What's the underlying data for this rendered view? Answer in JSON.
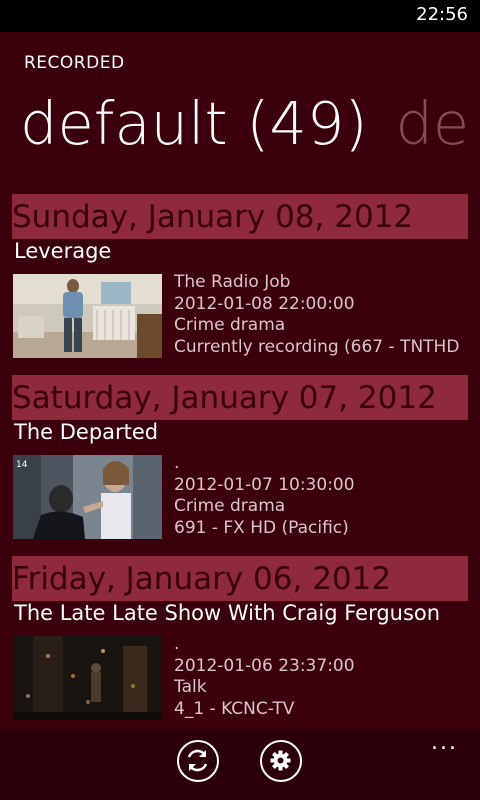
{
  "status_bar": {
    "time": "22:56"
  },
  "app": {
    "title": "RECORDED"
  },
  "pivot": {
    "active": "default (49)",
    "next_peek": "de"
  },
  "recordings": [
    {
      "date": "Sunday, January 08, 2012",
      "title": "Leverage",
      "details": [
        "The Radio Job",
        "2012-01-08 22:00:00",
        "Crime drama",
        "Currently recording (667 - TNTHD"
      ]
    },
    {
      "date": "Saturday, January 07, 2012",
      "title": "The Departed",
      "details": [
        ".",
        "2012-01-07 10:30:00",
        "Crime drama",
        "691 - FX HD (Pacific)"
      ]
    },
    {
      "date": "Friday, January 06, 2012",
      "title": "The Late Late Show With Craig Ferguson",
      "details": [
        ".",
        "2012-01-06 23:37:00",
        "Talk",
        "4_1 - KCNC-TV"
      ]
    }
  ],
  "app_bar": {
    "buttons": [
      "refresh-icon",
      "settings-icon"
    ],
    "more": "..."
  },
  "colors": {
    "background": "#3a000b",
    "accent": "#8f2a3c",
    "status_bar": "#000000"
  }
}
